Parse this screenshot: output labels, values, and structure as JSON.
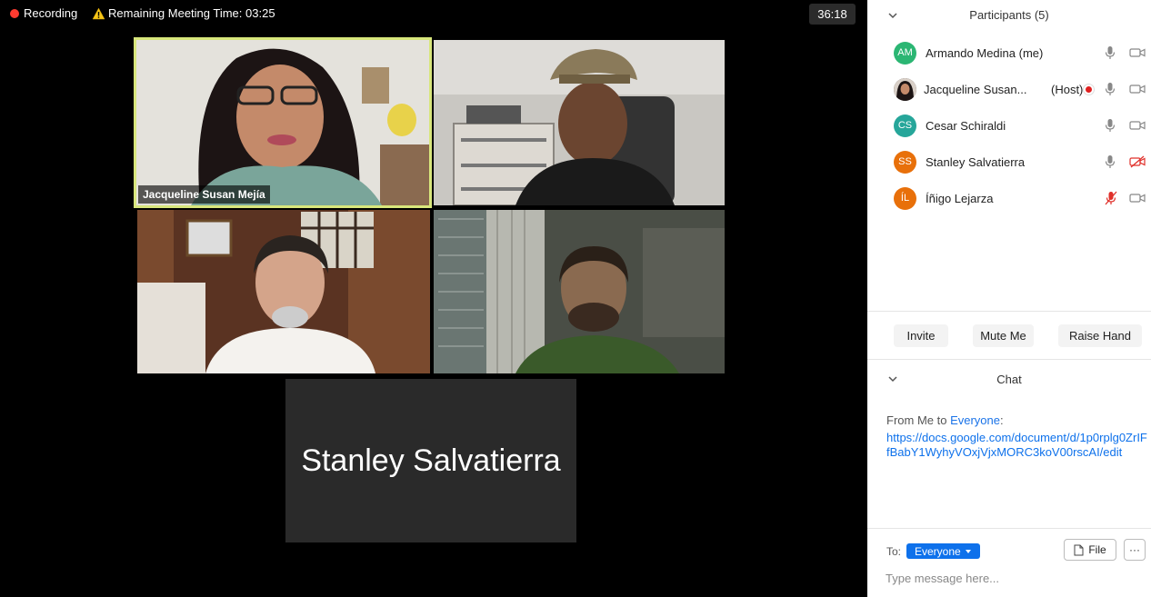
{
  "topbar": {
    "recording_label": "Recording",
    "remaining_label": "Remaining Meeting Time: 03:25",
    "elapsed": "36:18"
  },
  "videos": [
    {
      "name": "Jacqueline Susan Mejía",
      "active_speaker": true
    },
    {
      "name": ""
    },
    {
      "name": ""
    },
    {
      "name": ""
    }
  ],
  "camera_off_tile": {
    "name": "Stanley Salvatierra"
  },
  "participants": {
    "title": "Participants (5)",
    "items": [
      {
        "initials": "AM",
        "name": "Armando Medina (me)",
        "color": "#2bb673",
        "mic": "on",
        "cam": "on"
      },
      {
        "initials": "",
        "name": "Jacqueline Susan...",
        "role": "(Host)",
        "recording": true,
        "mic": "on",
        "cam": "on"
      },
      {
        "initials": "CS",
        "name": "Cesar Schiraldi",
        "color": "#26a69a",
        "mic": "on",
        "cam": "on"
      },
      {
        "initials": "SS",
        "name": "Stanley Salvatierra",
        "color": "#e8700a",
        "mic": "on",
        "cam": "off"
      },
      {
        "initials": "ÍL",
        "name": "Íñigo Lejarza",
        "color": "#e8700a",
        "mic": "off",
        "cam": "on"
      }
    ],
    "buttons": {
      "invite": "Invite",
      "mute": "Mute Me",
      "raise": "Raise Hand"
    }
  },
  "chat": {
    "title": "Chat",
    "from_prefix": "From Me to ",
    "from_target": "Everyone",
    "from_suffix": ":",
    "link": "https://docs.google.com/document/d/1p0rplg0ZrIFfBabY1WyhyVOxjVjxMORC3koV00rscAI/edit",
    "to_label": "To:",
    "to_value": "Everyone",
    "file_label": "File",
    "more_label": "···",
    "placeholder": "Type message here..."
  },
  "colors": {
    "accent": "#0e71eb",
    "active_border": "#d8e67c",
    "recording": "#ff3b30"
  }
}
